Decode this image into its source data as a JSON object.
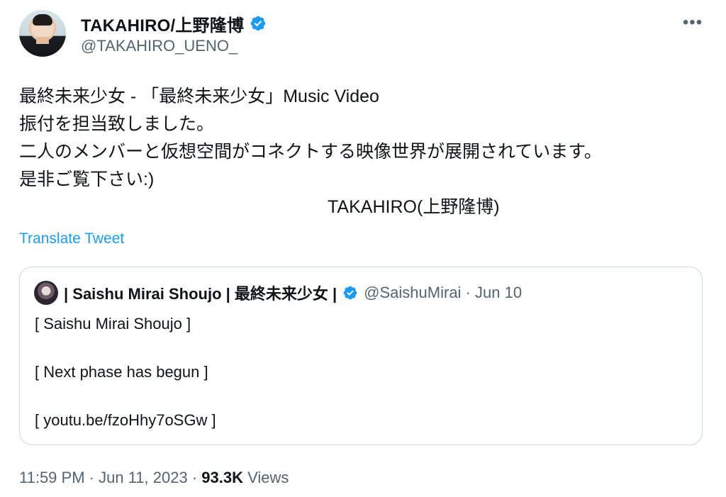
{
  "author": {
    "display_name": "TAKAHIRO/上野隆博",
    "handle": "@TAKAHIRO_UENO_",
    "verified": true
  },
  "menu": {
    "more_label": "•••"
  },
  "tweet_text": {
    "lines": [
      "最終未来少女 - 「最終未来少女」Music Video",
      "振付を担当致しました。",
      "二人のメンバーと仮想空間がコネクトする映像世界が展開されています。",
      "是非ご覧下さい:)",
      "TAKAHIRO(上野隆博)"
    ]
  },
  "translate_label": "Translate Tweet",
  "quote_tweet": {
    "display_name": "| Saishu Mirai Shoujo | 最終未来少女 |",
    "handle": "@SaishuMirai",
    "separator": "·",
    "date": "Jun 10",
    "lines": [
      "[ Saishu Mirai Shoujo ]",
      "",
      "[ Next phase has begun ]",
      "",
      "[ youtu.be/fzoHhy7oSGw ]"
    ]
  },
  "footer": {
    "time": "11:59 PM",
    "sep1": "·",
    "date": "Jun 11, 2023",
    "sep2": "·",
    "views_count": "93.3K",
    "views_label": "Views"
  },
  "colors": {
    "accent": "#1d9bf0",
    "text_primary": "#0f1419",
    "text_secondary": "#536471",
    "border": "#cfd9de"
  },
  "icons": {
    "verified": "verified-badge-icon",
    "more": "more-options-icon"
  }
}
